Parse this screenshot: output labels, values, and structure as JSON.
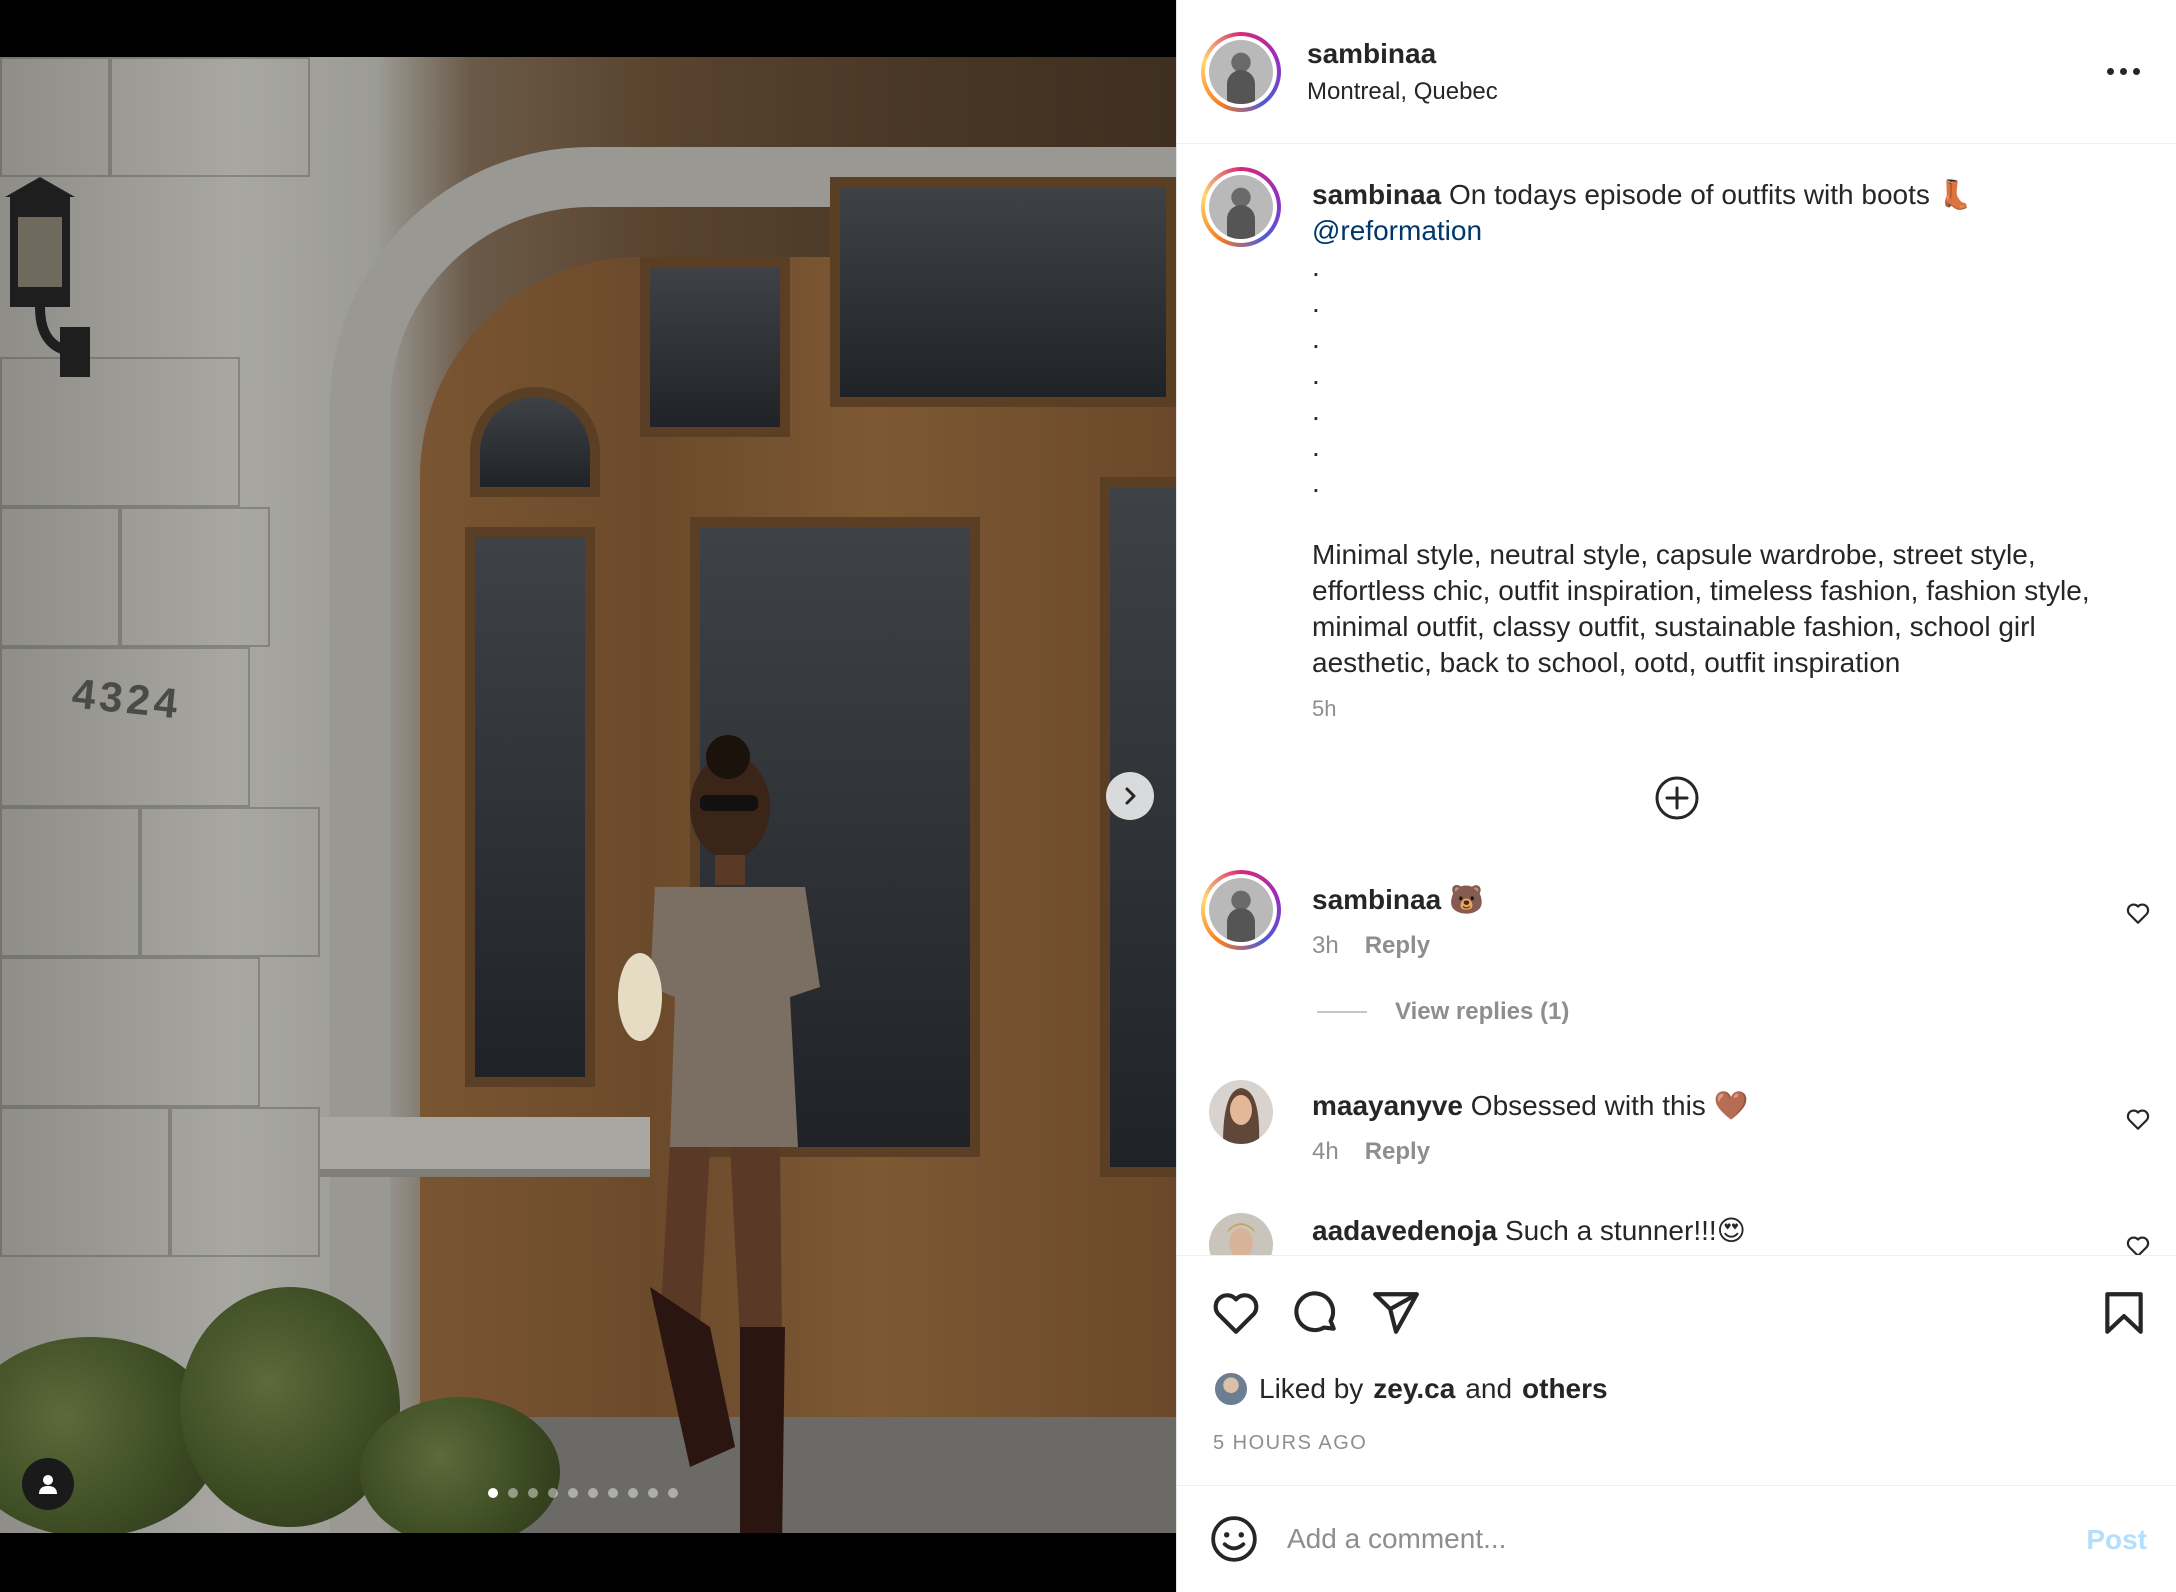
{
  "post": {
    "username": "sambinaa",
    "location": "Montreal, Quebec"
  },
  "photo": {
    "house_number": "4324",
    "dots_count": 10,
    "active_dot": 0
  },
  "caption": {
    "username": "sambinaa",
    "text": "On todays episode of outfits with boots 👢",
    "mention": "@reformation",
    "dot_lines": [
      ".",
      ".",
      ".",
      ".",
      ".",
      ".",
      "."
    ],
    "hashtags": "Minimal style, neutral style, capsule wardrobe, street style, effortless chic, outfit inspiration, timeless fashion, fashion style, minimal outfit, classy outfit, sustainable fashion, school girl aesthetic, back to school, ootd, outfit inspiration",
    "time": "5h"
  },
  "comments": [
    {
      "username": "sambinaa",
      "text": "🐻",
      "time": "3h",
      "reply_label": "Reply",
      "view_replies": "View replies (1)"
    },
    {
      "username": "maayanyve",
      "text": "Obsessed with this 🤎",
      "time": "4h",
      "reply_label": "Reply"
    },
    {
      "username": "aadavedenoja",
      "text": "Such a stunner!!!😍"
    }
  ],
  "likes": {
    "prefix": "Liked by",
    "user": "zey.ca",
    "conj": "and",
    "others": "others"
  },
  "timestamp": "5 HOURS AGO",
  "comment_box": {
    "placeholder": "Add a comment...",
    "post_label": "Post"
  },
  "colors": {
    "link": "#00376b",
    "muted": "#8e8e8e",
    "post_disabled": "#b2dffc"
  }
}
